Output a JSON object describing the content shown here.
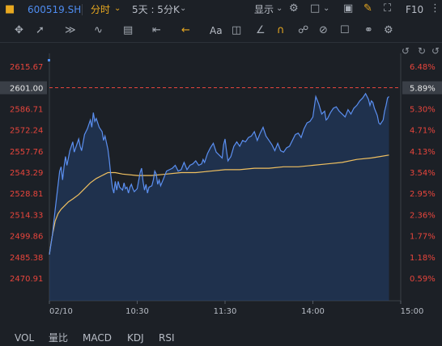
{
  "header": {
    "symbol": "600519.SH",
    "mode_tab": "分时",
    "period_select": "5天 : 5分K",
    "display_label": "显示",
    "f10_label": "F10"
  },
  "toolbar": {
    "icons": [
      "move-icon",
      "line-icon",
      "channel-icon",
      "wave-icon",
      "fib-icon",
      "range-icon",
      "arrow-icon",
      "text-icon",
      "comment-icon",
      "ruler-icon",
      "magnet-icon",
      "lock-drawing-icon",
      "hide-drawing-icon",
      "trash-icon",
      "compare-icon",
      "settings-icon"
    ],
    "tool_text": "Aa"
  },
  "indicators": [
    "VOL",
    "量比",
    "MACD",
    "KDJ",
    "RSI"
  ],
  "colors": {
    "price_line": "#5b8ff0",
    "avg_line": "#f0c060",
    "axis_up": "#e8453c",
    "area_fill": "#22406e",
    "ref_line": "#e8453c"
  },
  "chart_data": {
    "type": "line",
    "x_tick_labels": [
      "02/10",
      "10:30",
      "11:30",
      "14:00",
      "15:00"
    ],
    "x_ticks_minutes": [
      0,
      60,
      120,
      180,
      240
    ],
    "y_ticks": [
      2615.67,
      2601.0,
      2586.71,
      2572.24,
      2557.76,
      2543.29,
      2528.81,
      2514.33,
      2499.86,
      2485.38,
      2470.91
    ],
    "y_tick_labels": [
      "2615.67",
      "2601.00",
      "2586.71",
      "2572.24",
      "2557.76",
      "2543.29",
      "2528.81",
      "2514.33",
      "2499.86",
      "2485.38",
      "2470.91"
    ],
    "pct_tick_labels": [
      "6.48%",
      "5.89%",
      "5.30%",
      "4.71%",
      "4.13%",
      "3.54%",
      "2.95%",
      "2.36%",
      "1.77%",
      "1.18%",
      "0.59%"
    ],
    "ylim": [
      2460,
      2625
    ],
    "xlim": [
      0,
      240
    ],
    "reference_value": 2601.0,
    "series": [
      {
        "values": [
          [
            0,
            2487
          ],
          [
            2,
            2500
          ],
          [
            4,
            2518
          ],
          [
            6,
            2535
          ],
          [
            7,
            2544
          ],
          [
            8,
            2547
          ],
          [
            9,
            2538
          ],
          [
            10,
            2547
          ],
          [
            11,
            2554
          ],
          [
            12,
            2548
          ],
          [
            14,
            2558
          ],
          [
            16,
            2564
          ],
          [
            17,
            2557
          ],
          [
            18,
            2560
          ],
          [
            20,
            2566
          ],
          [
            21,
            2561
          ],
          [
            22,
            2558
          ],
          [
            24,
            2569
          ],
          [
            26,
            2573
          ],
          [
            28,
            2579
          ],
          [
            29,
            2574
          ],
          [
            30,
            2584
          ],
          [
            31,
            2578
          ],
          [
            32,
            2580
          ],
          [
            34,
            2574
          ],
          [
            36,
            2571
          ],
          [
            37,
            2565
          ],
          [
            38,
            2568
          ],
          [
            40,
            2559
          ],
          [
            41,
            2551
          ],
          [
            42,
            2541
          ],
          [
            43,
            2533
          ],
          [
            44,
            2529
          ],
          [
            45,
            2537
          ],
          [
            46,
            2531
          ],
          [
            47,
            2537
          ],
          [
            48,
            2533
          ],
          [
            50,
            2531
          ],
          [
            51,
            2536
          ],
          [
            52,
            2532
          ],
          [
            53,
            2533
          ],
          [
            54,
            2529
          ],
          [
            55,
            2533
          ],
          [
            56,
            2535
          ],
          [
            57,
            2532
          ],
          [
            58,
            2530
          ],
          [
            60,
            2532
          ],
          [
            62,
            2543
          ],
          [
            63,
            2546
          ],
          [
            64,
            2537
          ],
          [
            65,
            2531
          ],
          [
            66,
            2535
          ],
          [
            67,
            2529
          ],
          [
            68,
            2533
          ],
          [
            70,
            2534
          ],
          [
            71,
            2538
          ],
          [
            72,
            2544
          ],
          [
            73,
            2542
          ],
          [
            74,
            2535
          ],
          [
            75,
            2538
          ],
          [
            76,
            2534
          ],
          [
            78,
            2539
          ],
          [
            80,
            2544
          ],
          [
            82,
            2545
          ],
          [
            84,
            2546
          ],
          [
            86,
            2548
          ],
          [
            88,
            2544
          ],
          [
            90,
            2545
          ],
          [
            92,
            2550
          ],
          [
            94,
            2545
          ],
          [
            96,
            2548
          ],
          [
            98,
            2549
          ],
          [
            100,
            2551
          ],
          [
            102,
            2548
          ],
          [
            104,
            2549
          ],
          [
            105,
            2552
          ],
          [
            106,
            2550
          ],
          [
            108,
            2556
          ],
          [
            110,
            2560
          ],
          [
            112,
            2563
          ],
          [
            114,
            2557
          ],
          [
            116,
            2555
          ],
          [
            118,
            2553
          ],
          [
            119,
            2562
          ],
          [
            120,
            2566
          ],
          [
            121,
            2558
          ],
          [
            122,
            2551
          ],
          [
            124,
            2554
          ],
          [
            126,
            2561
          ],
          [
            128,
            2564
          ],
          [
            130,
            2561
          ],
          [
            132,
            2565
          ],
          [
            134,
            2564
          ],
          [
            136,
            2567
          ],
          [
            138,
            2568
          ],
          [
            140,
            2571
          ],
          [
            142,
            2565
          ],
          [
            144,
            2570
          ],
          [
            146,
            2574
          ],
          [
            148,
            2568
          ],
          [
            150,
            2565
          ],
          [
            152,
            2562
          ],
          [
            154,
            2558
          ],
          [
            156,
            2563
          ],
          [
            158,
            2558
          ],
          [
            160,
            2557
          ],
          [
            162,
            2560
          ],
          [
            164,
            2561
          ],
          [
            166,
            2565
          ],
          [
            168,
            2569
          ],
          [
            170,
            2570
          ],
          [
            172,
            2567
          ],
          [
            174,
            2573
          ],
          [
            176,
            2577
          ],
          [
            178,
            2578
          ],
          [
            180,
            2581
          ],
          [
            182,
            2595
          ],
          [
            184,
            2590
          ],
          [
            186,
            2583
          ],
          [
            188,
            2585
          ],
          [
            189,
            2579
          ],
          [
            190,
            2580
          ],
          [
            192,
            2584
          ],
          [
            194,
            2587
          ],
          [
            196,
            2588
          ],
          [
            198,
            2585
          ],
          [
            200,
            2583
          ],
          [
            202,
            2581
          ],
          [
            204,
            2586
          ],
          [
            206,
            2583
          ],
          [
            208,
            2587
          ],
          [
            210,
            2589
          ],
          [
            212,
            2592
          ],
          [
            214,
            2594
          ],
          [
            216,
            2597
          ],
          [
            218,
            2593
          ],
          [
            219,
            2589
          ],
          [
            220,
            2592
          ],
          [
            221,
            2591
          ],
          [
            222,
            2587
          ],
          [
            224,
            2582
          ],
          [
            225,
            2577
          ],
          [
            226,
            2576
          ],
          [
            228,
            2579
          ],
          [
            229,
            2585
          ],
          [
            230,
            2589
          ],
          [
            231,
            2594
          ],
          [
            232,
            2595
          ]
        ]
      },
      {
        "values": [
          [
            0,
            2487
          ],
          [
            1,
            2494
          ],
          [
            2,
            2500
          ],
          [
            3,
            2505
          ],
          [
            4,
            2510
          ],
          [
            6,
            2515
          ],
          [
            8,
            2518
          ],
          [
            10,
            2520
          ],
          [
            13,
            2523
          ],
          [
            16,
            2525
          ],
          [
            20,
            2528
          ],
          [
            24,
            2532
          ],
          [
            28,
            2536
          ],
          [
            32,
            2539
          ],
          [
            36,
            2541
          ],
          [
            38,
            2542
          ],
          [
            40,
            2543
          ],
          [
            45,
            2543
          ],
          [
            50,
            2542
          ],
          [
            60,
            2541
          ],
          [
            70,
            2541
          ],
          [
            80,
            2542
          ],
          [
            90,
            2543
          ],
          [
            100,
            2543
          ],
          [
            110,
            2544
          ],
          [
            120,
            2545
          ],
          [
            130,
            2545
          ],
          [
            140,
            2546
          ],
          [
            150,
            2546
          ],
          [
            160,
            2547
          ],
          [
            170,
            2547
          ],
          [
            180,
            2548
          ],
          [
            190,
            2549
          ],
          [
            200,
            2550
          ],
          [
            210,
            2552
          ],
          [
            220,
            2553
          ],
          [
            226,
            2554
          ],
          [
            232,
            2555
          ]
        ]
      }
    ]
  }
}
